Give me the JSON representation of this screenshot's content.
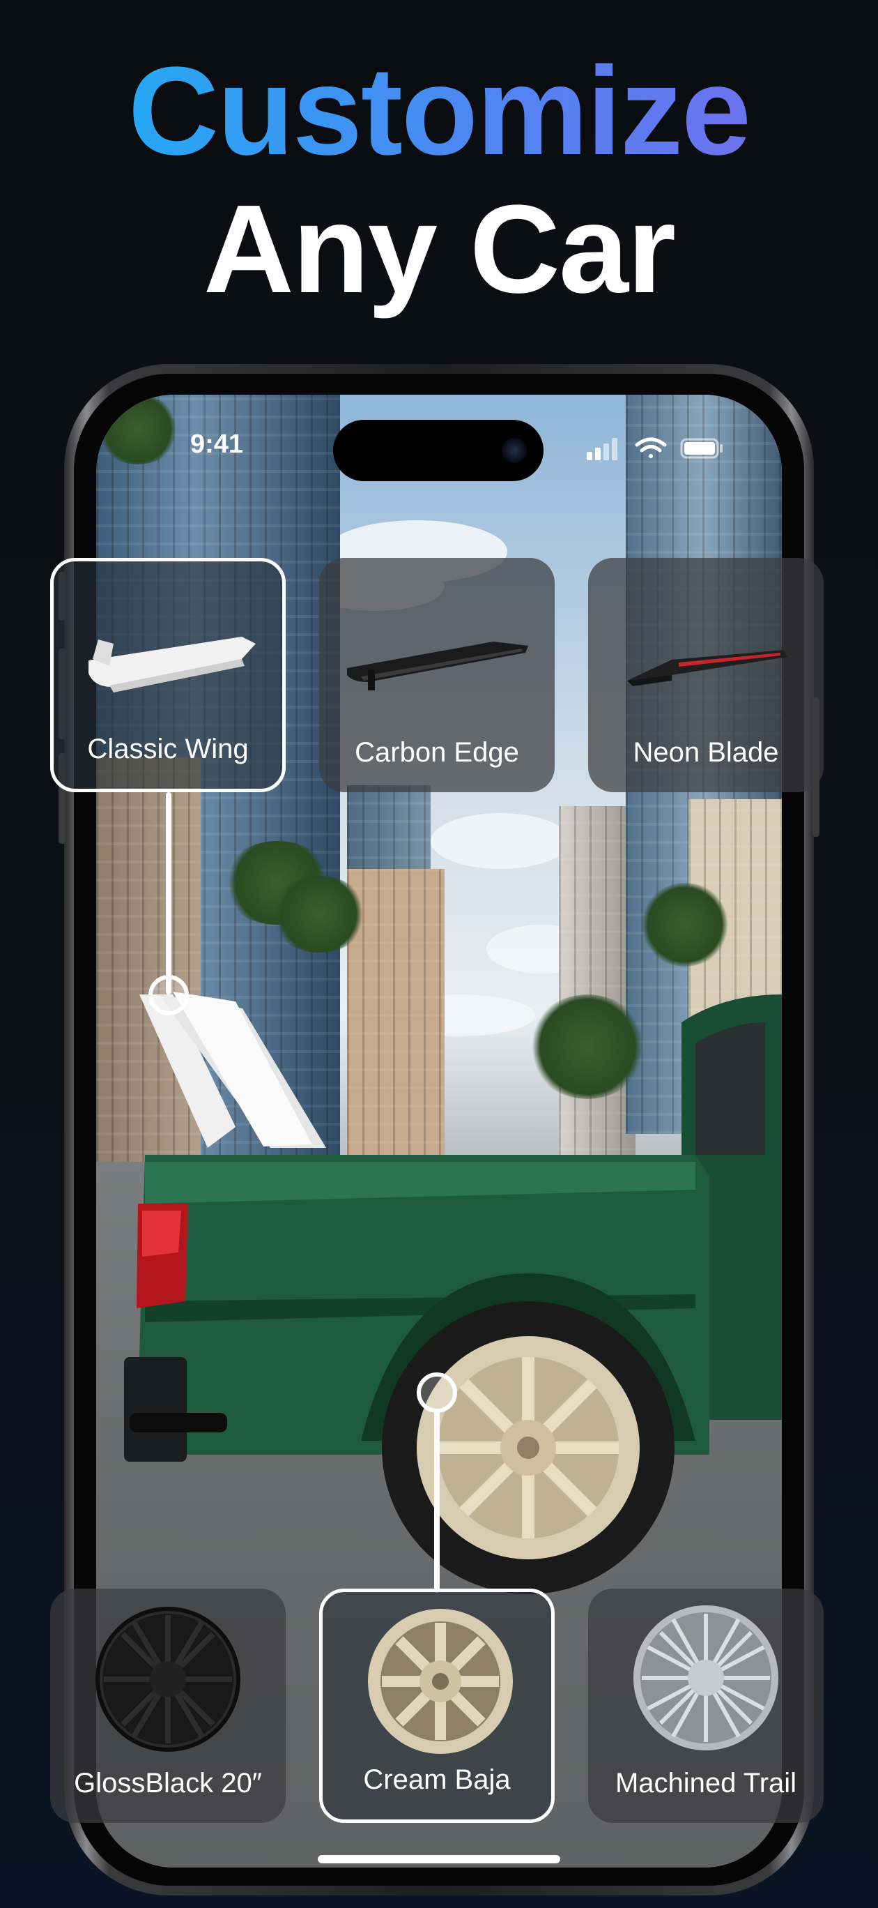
{
  "headline": {
    "line1": "Customize",
    "line2": "Any Car"
  },
  "status_bar": {
    "time": "9:41"
  },
  "spoiler_options": [
    {
      "label": "Classic Wing",
      "selected": true,
      "color": "#f2f2f2"
    },
    {
      "label": "Carbon Edge",
      "selected": false,
      "color": "#1b1b1b"
    },
    {
      "label": "Neon Blade",
      "selected": false,
      "color": "#1f1f1f"
    }
  ],
  "wheel_options": [
    {
      "label": "GlossBlack 20″",
      "selected": false,
      "color": "#141414"
    },
    {
      "label": "Cream Baja",
      "selected": true,
      "color": "#d8ccb0"
    },
    {
      "label": "Machined Trail",
      "selected": false,
      "color": "#c8cacc"
    }
  ],
  "colors": {
    "accent_start": "#17b4f5",
    "accent_end": "#7a68ee",
    "truck": "#1d5a3e"
  }
}
